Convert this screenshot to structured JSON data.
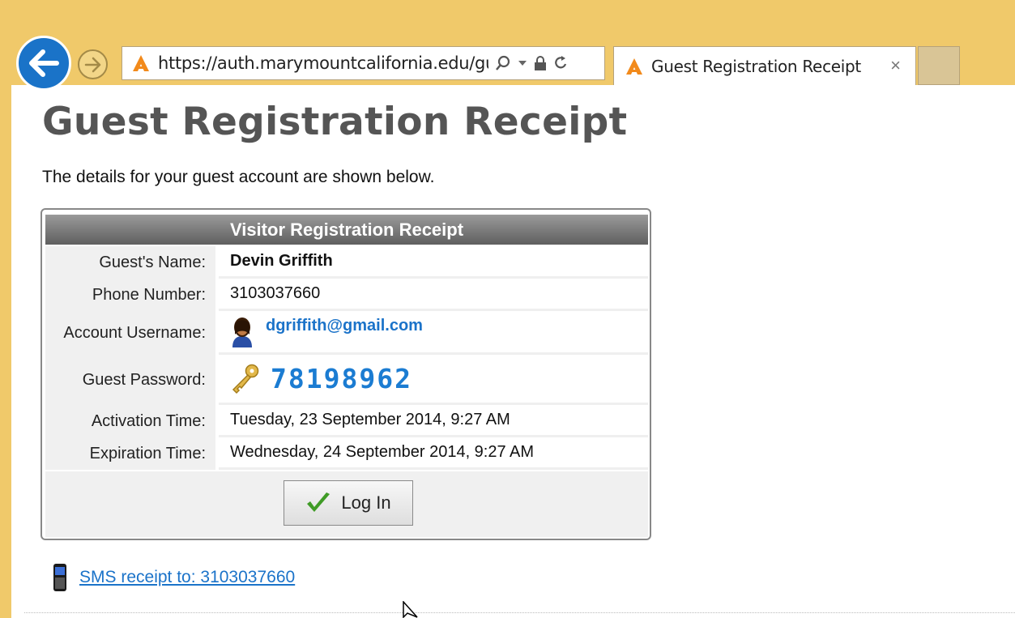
{
  "browser": {
    "url": "https://auth.marymountcalifornia.edu/gu",
    "tab_title": "Guest Registration Receipt",
    "tab_close": "×"
  },
  "page": {
    "title": "Guest Registration Receipt",
    "intro": "The details for your guest account are shown below."
  },
  "receipt": {
    "header": "Visitor Registration Receipt",
    "rows": [
      {
        "label": "Guest's Name:",
        "value": "Devin Griffith"
      },
      {
        "label": "Phone Number:",
        "value": "3103037660"
      },
      {
        "label": "Account Username:",
        "value": "dgriffith@gmail.com",
        "icon": "user-icon"
      },
      {
        "label": "Guest Password:",
        "value": "78198962",
        "icon": "key-icon"
      },
      {
        "label": "Activation Time:",
        "value": "Tuesday, 23 September 2014, 9:27 AM"
      },
      {
        "label": "Expiration Time:",
        "value": "Wednesday, 24 September 2014, 9:27 AM"
      }
    ],
    "login_button": "Log In"
  },
  "sms": {
    "link_text": "SMS receipt to: 3103037660",
    "icon": "phone-icon"
  },
  "colors": {
    "frame": "#f0c96a",
    "accent_blue": "#1b73c9",
    "header_grey": "#6e6e6e"
  }
}
